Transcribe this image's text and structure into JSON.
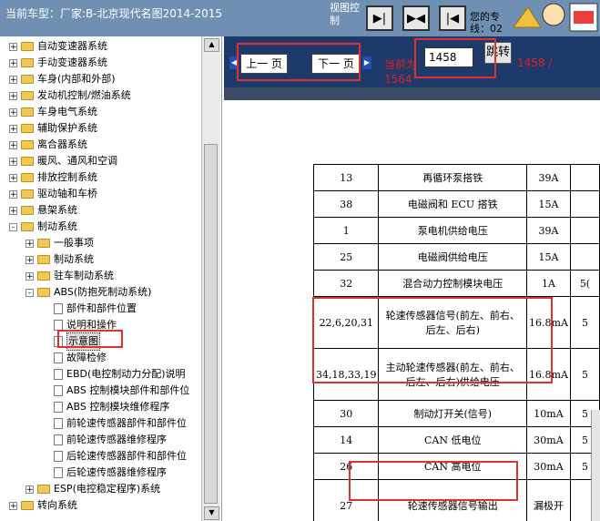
{
  "header": {
    "car_title": "当前车型：厂家:B-北京现代名图2014-2015",
    "view_control_label": "视图控制",
    "view_buttons": [
      "▶|",
      "▶◀",
      "|◀"
    ],
    "hint": "您的专 线：02"
  },
  "tree": {
    "items": [
      {
        "label": "自动变速器系统",
        "level": 0,
        "expander": "+",
        "type": "folder"
      },
      {
        "label": "手动变速器系统",
        "level": 0,
        "expander": "+",
        "type": "folder"
      },
      {
        "label": "车身(内部和外部)",
        "level": 0,
        "expander": "+",
        "type": "folder"
      },
      {
        "label": "发动机控制/燃油系统",
        "level": 0,
        "expander": "+",
        "type": "folder"
      },
      {
        "label": "车身电气系统",
        "level": 0,
        "expander": "+",
        "type": "folder"
      },
      {
        "label": "辅助保护系统",
        "level": 0,
        "expander": "+",
        "type": "folder"
      },
      {
        "label": "离合器系统",
        "level": 0,
        "expander": "+",
        "type": "folder"
      },
      {
        "label": "暖风、通风和空调",
        "level": 0,
        "expander": "+",
        "type": "folder"
      },
      {
        "label": "排放控制系统",
        "level": 0,
        "expander": "+",
        "type": "folder"
      },
      {
        "label": "驱动轴和车桥",
        "level": 0,
        "expander": "+",
        "type": "folder"
      },
      {
        "label": "悬架系统",
        "level": 0,
        "expander": "+",
        "type": "folder"
      },
      {
        "label": "制动系统",
        "level": 0,
        "expander": "-",
        "type": "folder"
      },
      {
        "label": "一般事项",
        "level": 1,
        "expander": "+",
        "type": "folder"
      },
      {
        "label": "制动系统",
        "level": 1,
        "expander": "+",
        "type": "folder"
      },
      {
        "label": "驻车制动系统",
        "level": 1,
        "expander": "+",
        "type": "folder"
      },
      {
        "label": "ABS(防抱死制动系统)",
        "level": 1,
        "expander": "-",
        "type": "folder"
      },
      {
        "label": "部件和部件位置",
        "level": 2,
        "expander": "",
        "type": "doc"
      },
      {
        "label": "说明和操作",
        "level": 2,
        "expander": "",
        "type": "doc"
      },
      {
        "label": "示意图",
        "level": 2,
        "expander": "",
        "type": "doc",
        "selected": true
      },
      {
        "label": "故障检修",
        "level": 2,
        "expander": "",
        "type": "doc"
      },
      {
        "label": "EBD(电控制动力分配)说明",
        "level": 2,
        "expander": "",
        "type": "doc"
      },
      {
        "label": "ABS 控制模块部件和部件位",
        "level": 2,
        "expander": "",
        "type": "doc"
      },
      {
        "label": "ABS 控制模块维修程序",
        "level": 2,
        "expander": "",
        "type": "doc"
      },
      {
        "label": "前轮速传感器部件和部件位",
        "level": 2,
        "expander": "",
        "type": "doc"
      },
      {
        "label": "前轮速传感器维修程序",
        "level": 2,
        "expander": "",
        "type": "doc"
      },
      {
        "label": "后轮速传感器部件和部件位",
        "level": 2,
        "expander": "",
        "type": "doc"
      },
      {
        "label": "后轮速传感器维修程序",
        "level": 2,
        "expander": "",
        "type": "doc"
      },
      {
        "label": "ESP(电控稳定程序)系统",
        "level": 1,
        "expander": "+",
        "type": "folder"
      },
      {
        "label": "转向系统",
        "level": 0,
        "expander": "+",
        "type": "folder"
      }
    ]
  },
  "nav": {
    "prev_label": "上一 页",
    "next_label": "下一 页",
    "current_label": "当前为",
    "page_value": "1458",
    "jump_label": "跳转",
    "page_total": "1458 /",
    "page_total2": "1564"
  },
  "pin_table": {
    "rows": [
      [
        "13",
        "再循环泵搭铁",
        "39A",
        ""
      ],
      [
        "38",
        "电磁阀和 ECU 搭铁",
        "15A",
        ""
      ],
      [
        "1",
        "泵电机供给电压",
        "39A",
        ""
      ],
      [
        "25",
        "电磁阀供给电压",
        "15A",
        ""
      ],
      [
        "32",
        "混合动力控制模块电压",
        "1A",
        "5("
      ],
      [
        "22,6,20,31",
        "轮速传感器信号(前左、前右、后左、后右)",
        "16.8mA",
        "5"
      ],
      [
        "34,18,33,19",
        "主动轮速传感器(前左、前右、后左、后右)供给电压",
        "16.8mA",
        "5"
      ],
      [
        "30",
        "制动灯开关(信号)",
        "10mA",
        "5"
      ],
      [
        "14",
        "CAN 低电位",
        "30mA",
        "5"
      ],
      [
        "26",
        "CAN 高电位",
        "30mA",
        "5"
      ],
      [
        "27",
        "轮速传感器信号输出",
        "漏极开",
        ""
      ]
    ]
  },
  "colors": {
    "header_bg": "#6f8fb3",
    "nav_bg": "#1e3a6a",
    "highlight": "#e03030"
  }
}
